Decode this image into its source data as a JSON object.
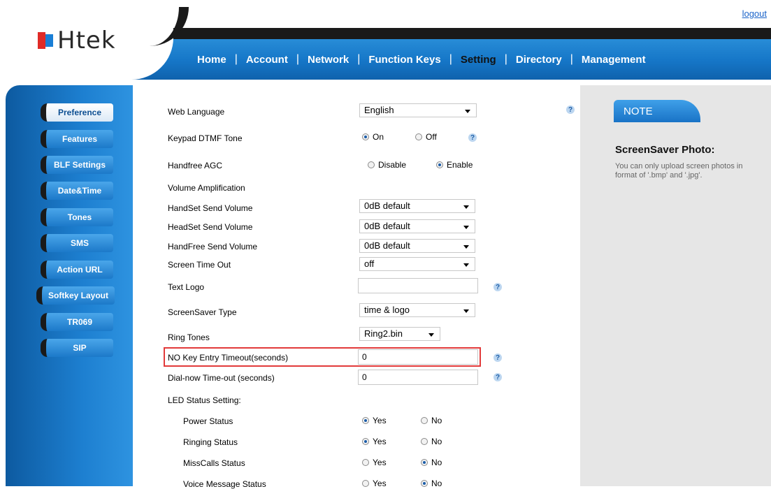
{
  "header": {
    "logout": "logout",
    "logo_text": "Htek",
    "nav": [
      {
        "label": "Home"
      },
      {
        "label": "Account"
      },
      {
        "label": "Network"
      },
      {
        "label": "Function Keys"
      },
      {
        "label": "Setting",
        "active": true
      },
      {
        "label": "Directory"
      },
      {
        "label": "Management"
      }
    ]
  },
  "sidebar": {
    "items": [
      {
        "label": "Preference",
        "active": true
      },
      {
        "label": "Features"
      },
      {
        "label": "BLF Settings"
      },
      {
        "label": "Date&Time"
      },
      {
        "label": "Tones"
      },
      {
        "label": "SMS"
      },
      {
        "label": "Action URL"
      },
      {
        "label": "Softkey Layout"
      },
      {
        "label": "TR069"
      },
      {
        "label": "SIP"
      }
    ]
  },
  "form": {
    "web_language": {
      "label": "Web Language",
      "value": "English"
    },
    "keypad_dtmf": {
      "label": "Keypad DTMF Tone",
      "on": "On",
      "off": "Off",
      "selected": "On"
    },
    "handfree_agc": {
      "label": "Handfree AGC",
      "disable": "Disable",
      "enable": "Enable",
      "selected": "Enable"
    },
    "volume_amp": {
      "label": "Volume Amplification"
    },
    "handset_send": {
      "label": "HandSet Send Volume",
      "value": "0dB default"
    },
    "headset_send": {
      "label": "HeadSet Send Volume",
      "value": "0dB default"
    },
    "handfree_send": {
      "label": "HandFree Send Volume",
      "value": "0dB default"
    },
    "screen_timeout": {
      "label": "Screen Time Out",
      "value": "off"
    },
    "text_logo": {
      "label": "Text Logo",
      "value": ""
    },
    "screensaver_type": {
      "label": "ScreenSaver Type",
      "value": "time & logo"
    },
    "ring_tones": {
      "label": "Ring Tones",
      "value": "Ring2.bin"
    },
    "no_key_timeout": {
      "label": "NO Key Entry Timeout(seconds)",
      "value": "0"
    },
    "dialnow_timeout": {
      "label": "Dial-now Time-out (seconds)",
      "value": "0"
    },
    "led_status": {
      "label": "LED Status Setting:"
    },
    "led_items": [
      {
        "label": "Power Status",
        "yes": "Yes",
        "no": "No",
        "selected": "Yes"
      },
      {
        "label": "Ringing Status",
        "yes": "Yes",
        "no": "No",
        "selected": "Yes"
      },
      {
        "label": "MissCalls Status",
        "yes": "Yes",
        "no": "No",
        "selected": "No"
      },
      {
        "label": "Voice Message Status",
        "yes": "Yes",
        "no": "No",
        "selected": "No"
      }
    ],
    "help_glyph": "?"
  },
  "note": {
    "tab": "NOTE",
    "title": "ScreenSaver Photo:",
    "text": "You can only upload screen photos in format of '.bmp' and '.jpg'."
  }
}
